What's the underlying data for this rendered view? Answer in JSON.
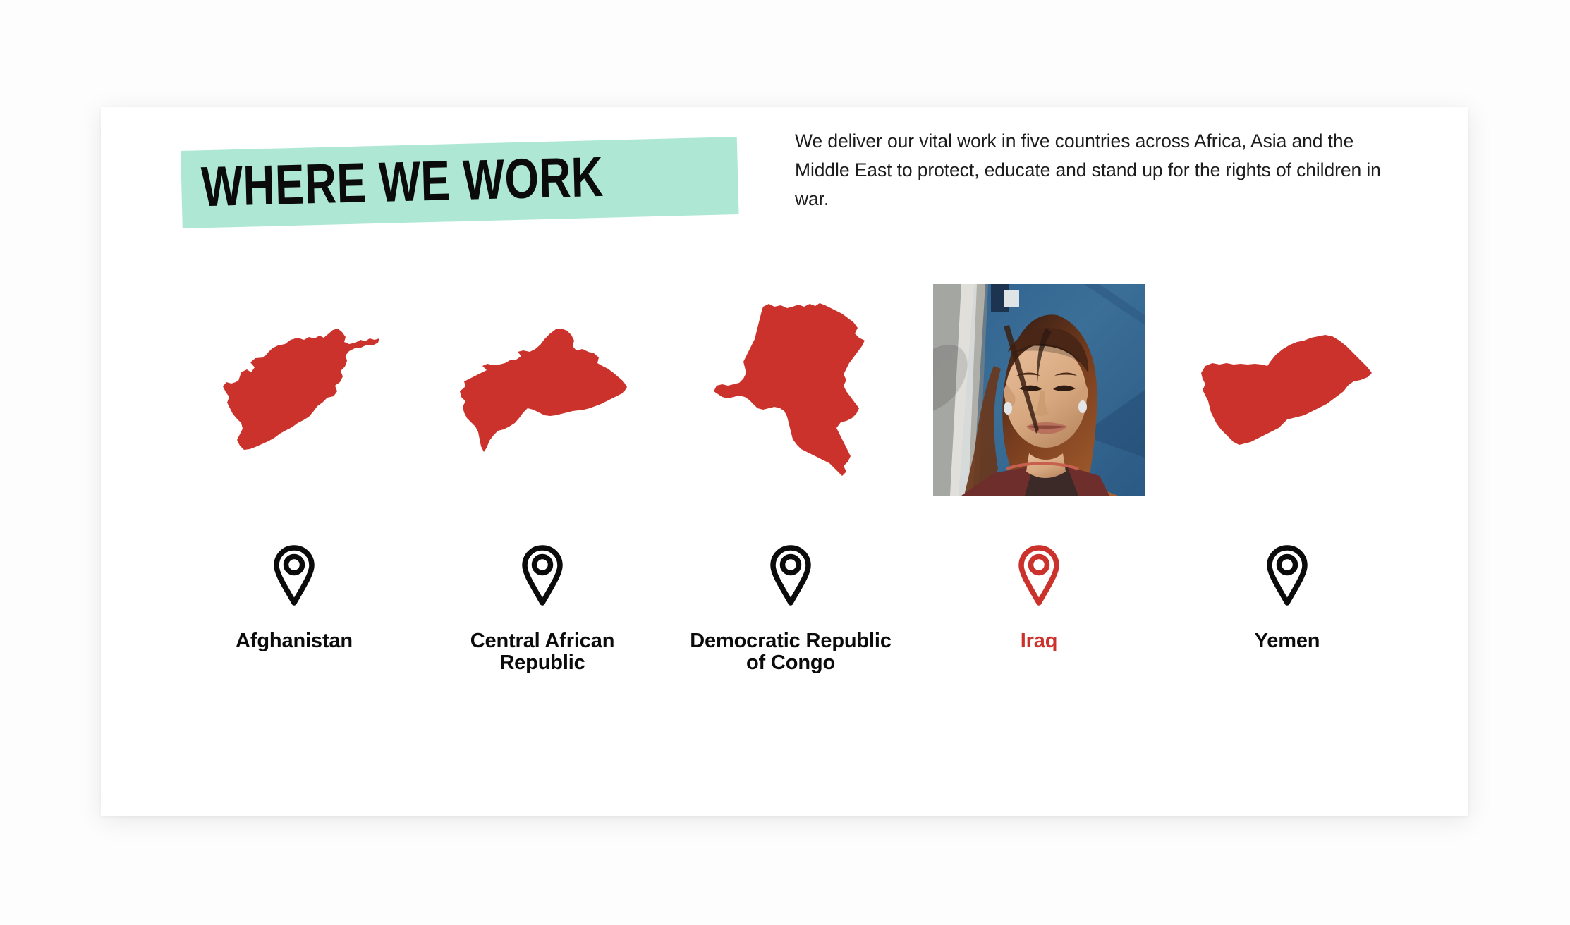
{
  "theme": {
    "page_background": "#fdfdfd",
    "card_background": "#ffffff",
    "highlight_mint": "#aee8d5",
    "map_red": "#cc322c",
    "active_red": "#cc322c",
    "text_black": "#0b0b0b"
  },
  "header": {
    "title": "WHERE WE WORK",
    "paragraph": "We deliver our vital work in five countries across Africa, Asia and the Middle East to protect, educate and stand up for the rights of children in war."
  },
  "countries": [
    {
      "name": "Afghanistan",
      "visual": "map-silhouette",
      "map_icon": "afghanistan-map-shape",
      "pin_icon": "map-pin-icon",
      "active": false
    },
    {
      "name": "Central African Republic",
      "visual": "map-silhouette",
      "map_icon": "central-african-republic-map-shape",
      "pin_icon": "map-pin-icon",
      "active": false
    },
    {
      "name": "Democratic Republic of Congo",
      "visual": "map-silhouette",
      "map_icon": "democratic-republic-of-congo-map-shape",
      "pin_icon": "map-pin-icon",
      "active": false
    },
    {
      "name": "Iraq",
      "visual": "photo",
      "photo_description": "Smiling girl with long auburn hair in front of a blue tent tarpaulin",
      "pin_icon": "map-pin-icon",
      "active": true
    },
    {
      "name": "Yemen",
      "visual": "map-silhouette",
      "map_icon": "yemen-map-shape",
      "pin_icon": "map-pin-icon",
      "active": false
    }
  ]
}
